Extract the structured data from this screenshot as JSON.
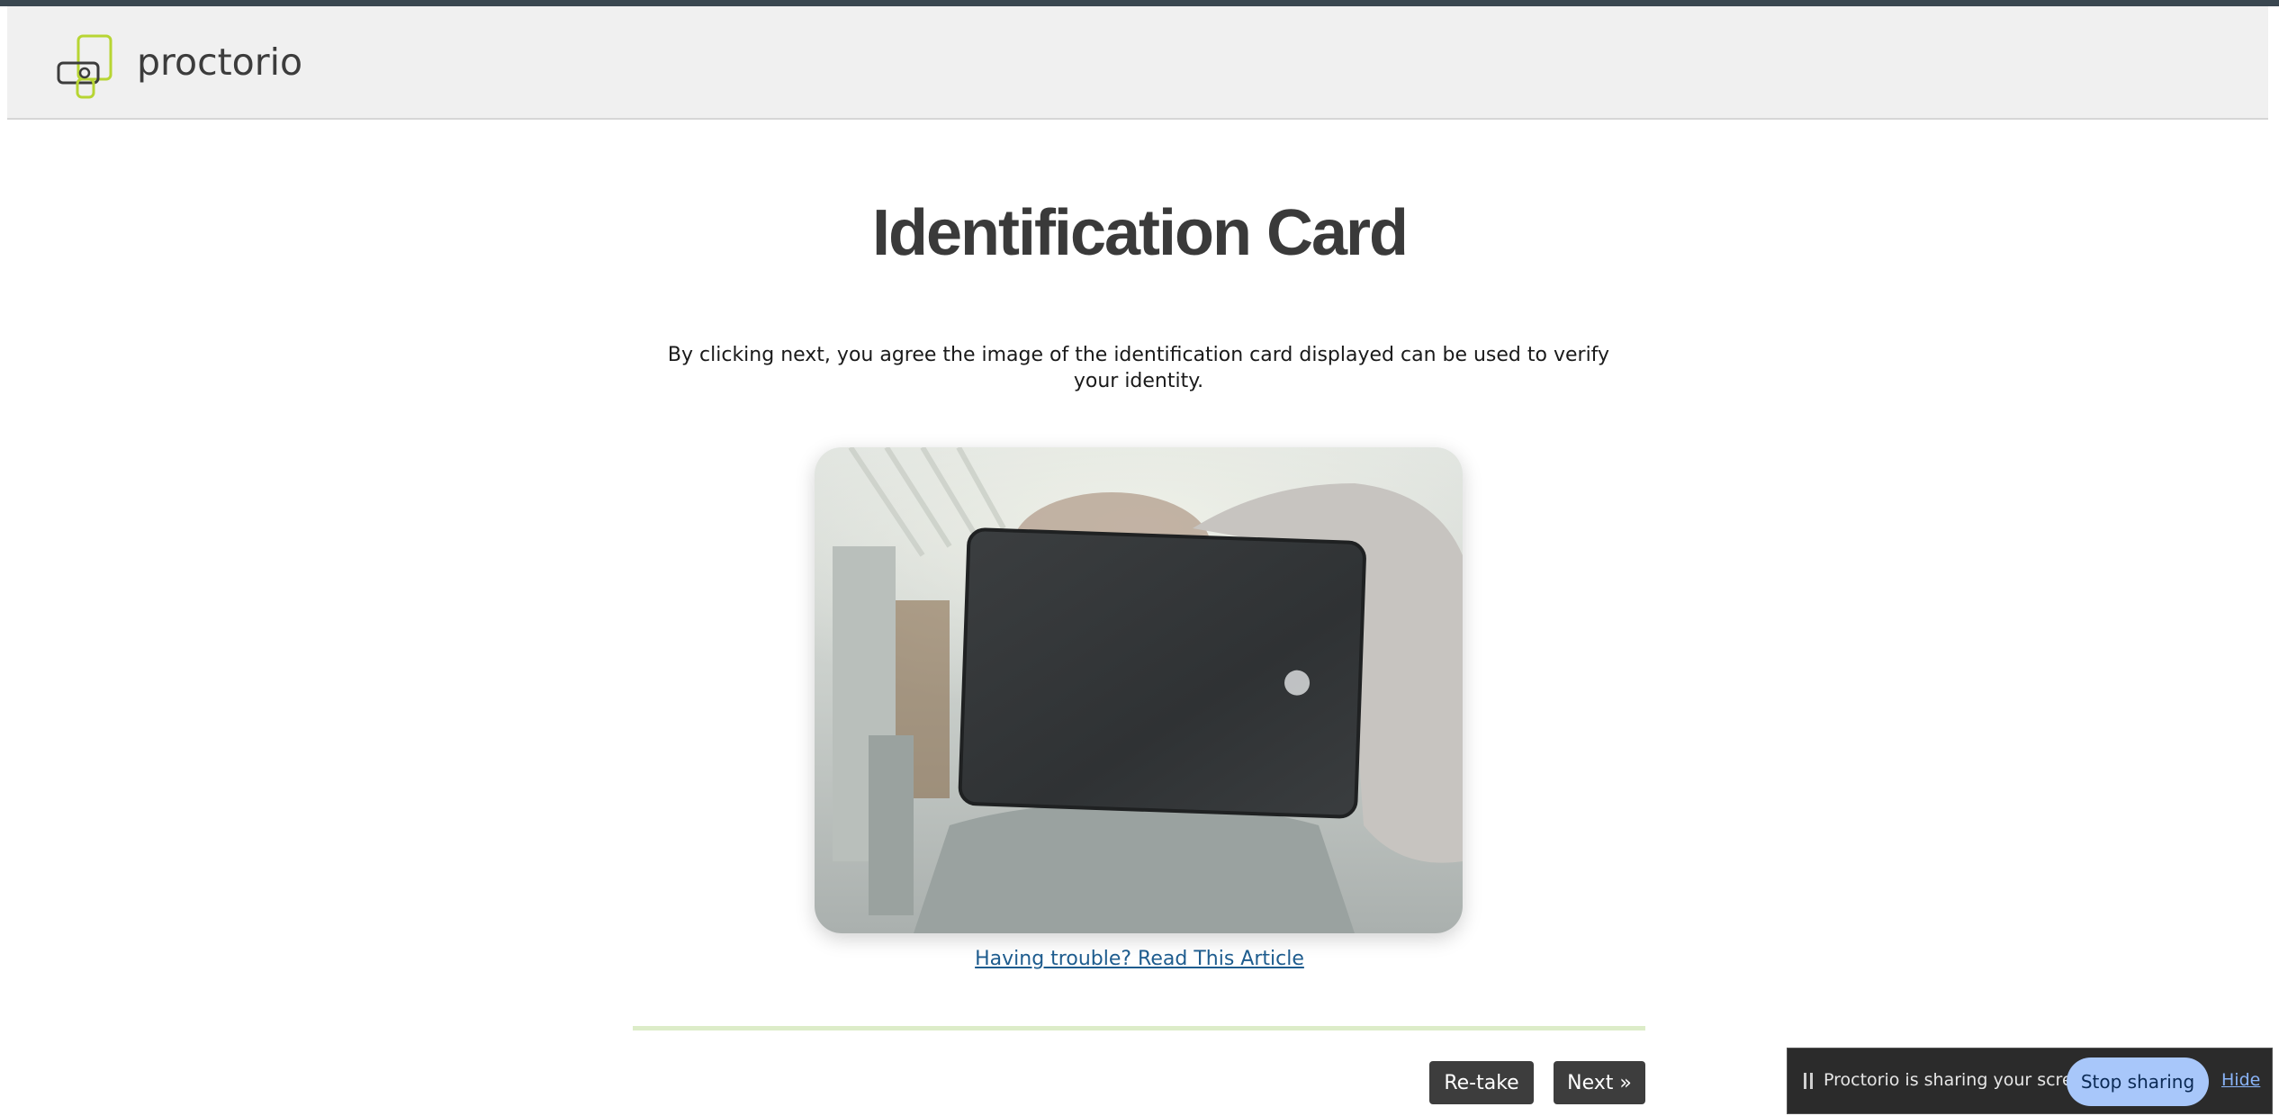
{
  "header": {
    "brand": "proctorio",
    "logo_icon": "proctorio-logo-icon",
    "brand_color": "#a6c739"
  },
  "main": {
    "title": "Identification Card",
    "description": "By clicking next, you agree the image of the identification card displayed can be used to verify your identity.",
    "photo_icon": "webcam-capture-image",
    "help_link": "Having trouble? Read This Article"
  },
  "footer": {
    "retake_label": "Re-take",
    "next_label": "Next »"
  },
  "share_bar": {
    "message": "Proctorio is sharing your screen.",
    "stop_label": "Stop sharing",
    "hide_label": "Hide",
    "pause_icon": "pause-icon"
  },
  "colors": {
    "accent_button": "#3d3d3d",
    "link": "#1e5c8e",
    "stop_button": "#a8c7fa"
  }
}
